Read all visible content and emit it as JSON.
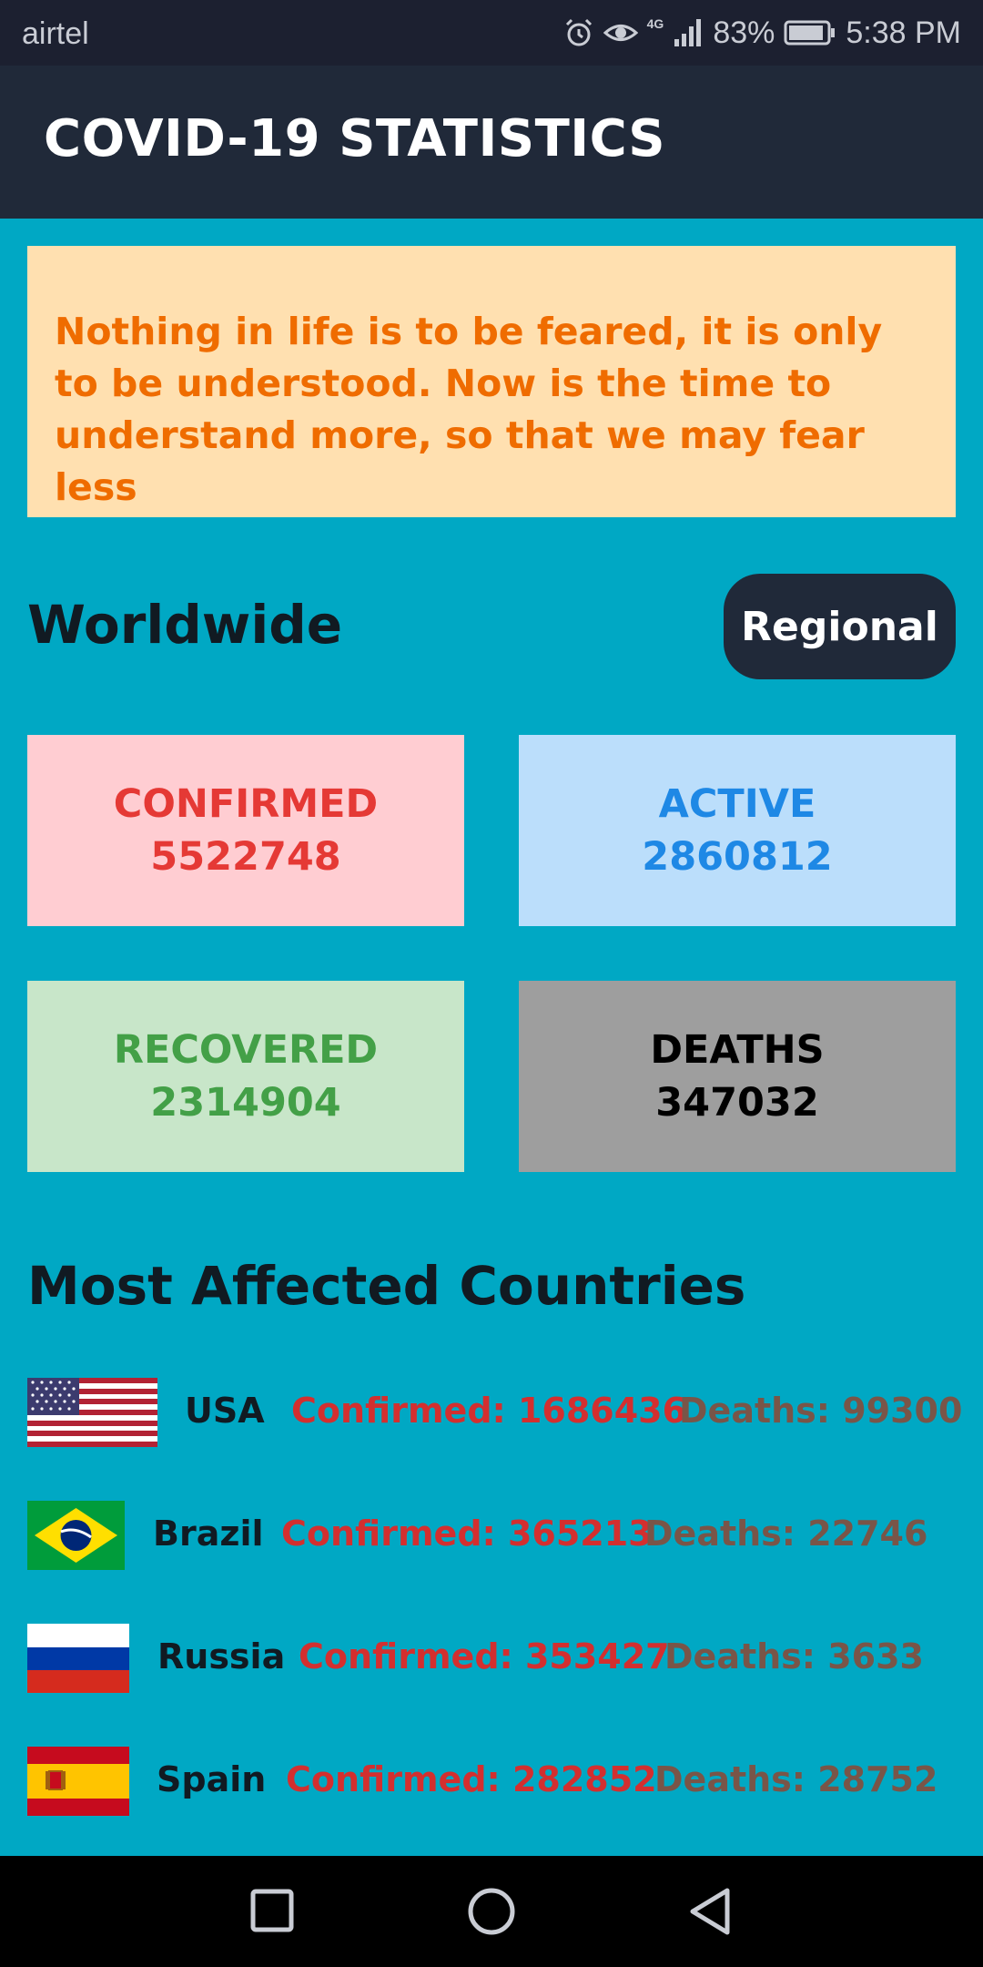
{
  "status_bar": {
    "carrier": "airtel",
    "network": "4G",
    "battery": "83%",
    "time": "5:38 PM"
  },
  "app_bar": {
    "title": "COVID-19 STATISTICS"
  },
  "quote": {
    "text": "Nothing in life is to be feared, it is only to be understood. Now is the time to understand more, so that we may fear less"
  },
  "worldwide": {
    "title": "Worldwide",
    "regional_button": "Regional",
    "stats": {
      "confirmed": {
        "label": "CONFIRMED",
        "value": "5522748"
      },
      "active": {
        "label": "ACTIVE",
        "value": "2860812"
      },
      "recovered": {
        "label": "RECOVERED",
        "value": "2314904"
      },
      "deaths": {
        "label": "DEATHS",
        "value": "347032"
      }
    }
  },
  "most_affected": {
    "title": "Most Affected Countries",
    "countries": [
      {
        "name": "USA",
        "confirmed": "Confirmed: 1686436",
        "deaths": "Deaths: 99300",
        "flag": "us-flag"
      },
      {
        "name": "Brazil",
        "confirmed": "Confirmed: 365213",
        "deaths": "Deaths: 22746",
        "flag": "brazil-flag"
      },
      {
        "name": "Russia",
        "confirmed": "Confirmed: 353427",
        "deaths": "Deaths: 3633",
        "flag": "russia-flag"
      },
      {
        "name": "Spain",
        "confirmed": "Confirmed: 282852",
        "deaths": "Deaths: 28752",
        "flag": "spain-flag"
      }
    ]
  },
  "colors": {
    "background": "#00a8c4",
    "app_bar": "#202939",
    "confirmed": "#e53935",
    "active": "#1e88e5",
    "recovered": "#43a047",
    "quote_text": "#ef6c00"
  }
}
